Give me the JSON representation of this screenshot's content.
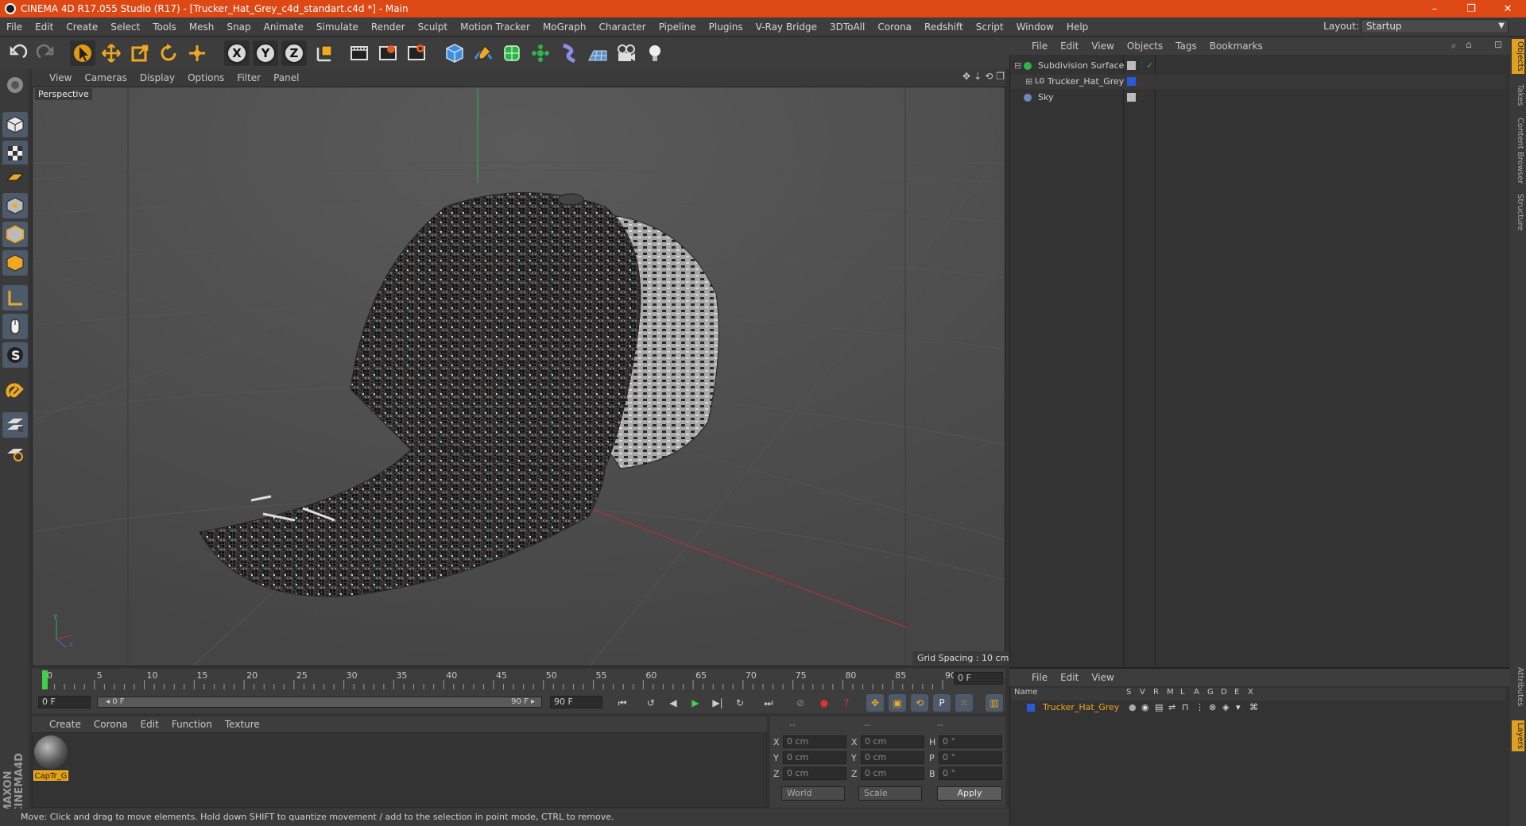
{
  "window": {
    "title": "CINEMA 4D R17.055 Studio (R17) - [Trucker_Hat_Grey_c4d_standart.c4d *] - Main",
    "minimize": "–",
    "restore": "❐",
    "close": "✕"
  },
  "menubar": {
    "items": [
      "File",
      "Edit",
      "Create",
      "Select",
      "Tools",
      "Mesh",
      "Snap",
      "Animate",
      "Simulate",
      "Render",
      "Sculpt",
      "Motion Tracker",
      "MoGraph",
      "Character",
      "Pipeline",
      "Plugins",
      "V-Ray Bridge",
      "3DToAll",
      "Corona",
      "Redshift",
      "Script",
      "Window",
      "Help"
    ],
    "layout_label": "Layout:",
    "layout_value": "Startup"
  },
  "toolbar": {
    "icons": [
      "undo-icon",
      "redo-icon",
      "select-icon",
      "move-icon",
      "scale-icon",
      "rotate-icon",
      "live-select-icon",
      "x-axis-icon",
      "y-axis-icon",
      "z-axis-icon",
      "coordinate-system-icon",
      "render-view-icon",
      "render-picture-viewer-icon",
      "render-settings-icon",
      "cube-icon",
      "spline-pen-icon",
      "subdivision-icon",
      "array-icon",
      "deformer-icon",
      "floor-icon",
      "camera-icon",
      "light-icon"
    ],
    "axis_x": "X",
    "axis_y": "Y",
    "axis_z": "Z"
  },
  "viewport": {
    "menu": [
      "View",
      "Cameras",
      "Display",
      "Options",
      "Filter",
      "Panel"
    ],
    "label": "Perspective",
    "grid_spacing": "Grid Spacing : 10 cm"
  },
  "timeline": {
    "ticks": [
      "0",
      "5",
      "10",
      "15",
      "20",
      "25",
      "30",
      "35",
      "40",
      "45",
      "50",
      "55",
      "60",
      "65",
      "70",
      "75",
      "80",
      "85",
      "90"
    ],
    "current_frame": "0 F",
    "start_field": "0 F",
    "slider_left": "◂ 0 F",
    "slider_right": "90 F ▸",
    "end_field": "90 F"
  },
  "material_manager": {
    "menu": [
      "Create",
      "Corona",
      "Edit",
      "Function",
      "Texture"
    ],
    "material_name": "CapTr_G"
  },
  "coordinates": {
    "header": [
      "--",
      "--",
      "--"
    ],
    "rows": [
      {
        "l1": "X",
        "v1": "0 cm",
        "l2": "X",
        "v2": "0 cm",
        "l3": "H",
        "v3": "0 °"
      },
      {
        "l1": "Y",
        "v1": "0 cm",
        "l2": "Y",
        "v2": "0 cm",
        "l3": "P",
        "v3": "0 °"
      },
      {
        "l1": "Z",
        "v1": "0 cm",
        "l2": "Z",
        "v2": "0 cm",
        "l3": "B",
        "v3": "0 °"
      }
    ],
    "world": "World",
    "scale": "Scale",
    "apply": "Apply"
  },
  "status": "Move: Click and drag to move elements. Hold down SHIFT to quantize movement / add to the selection in point mode, CTRL to remove.",
  "object_manager": {
    "menu": [
      "File",
      "Edit",
      "View",
      "Objects",
      "Tags",
      "Bookmarks"
    ],
    "objects": [
      {
        "name": "Subdivision Surface",
        "icon": "subdivision-icon"
      },
      {
        "name": "Trucker_Hat_Grey",
        "icon": "polygon-object-icon"
      },
      {
        "name": "Sky",
        "icon": "sky-icon"
      }
    ]
  },
  "layer_manager": {
    "menu": [
      "File",
      "Edit",
      "View"
    ],
    "columns": [
      "Name",
      "S",
      "V",
      "R",
      "M",
      "L",
      "A",
      "G",
      "D",
      "E",
      "X"
    ],
    "layer_name": "Trucker_Hat_Grey"
  },
  "side_tabs": [
    "Objects",
    "Takes",
    "Content Browser",
    "Structure",
    "Attributes",
    "Layers"
  ],
  "colors": {
    "title_bar": "#de4815",
    "accent_orange": "#e8a012",
    "panel": "#3d3d3d",
    "viewport": "#4a4a4a"
  }
}
